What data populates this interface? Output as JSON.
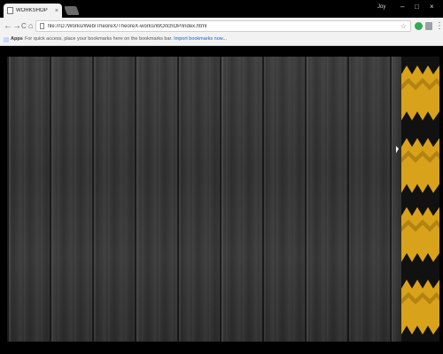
{
  "browser": {
    "tab_title": "WORKSHOP",
    "tab_close": "×",
    "profile_name": "Joy",
    "window_controls": {
      "minimize": "–",
      "maximize": "□",
      "close": "×"
    }
  },
  "toolbar": {
    "back": "←",
    "forward": "→",
    "reload": "C",
    "home": "⌂",
    "url": "file:///D:/Works/Web/TheoreX/TheoreX-works/WOrlchOP/index.html",
    "star": "☆",
    "menu": "⋮"
  },
  "bookmarks_bar": {
    "apps_label": "Apps",
    "hint_text": "For quick access, place your bookmarks here on the bookmarks bar.",
    "import_link": "Import bookmarks now..."
  },
  "page": {
    "background_color": "#000000",
    "wood_color": "#3a3a3a",
    "stripe_accent": "#d9a21b"
  }
}
